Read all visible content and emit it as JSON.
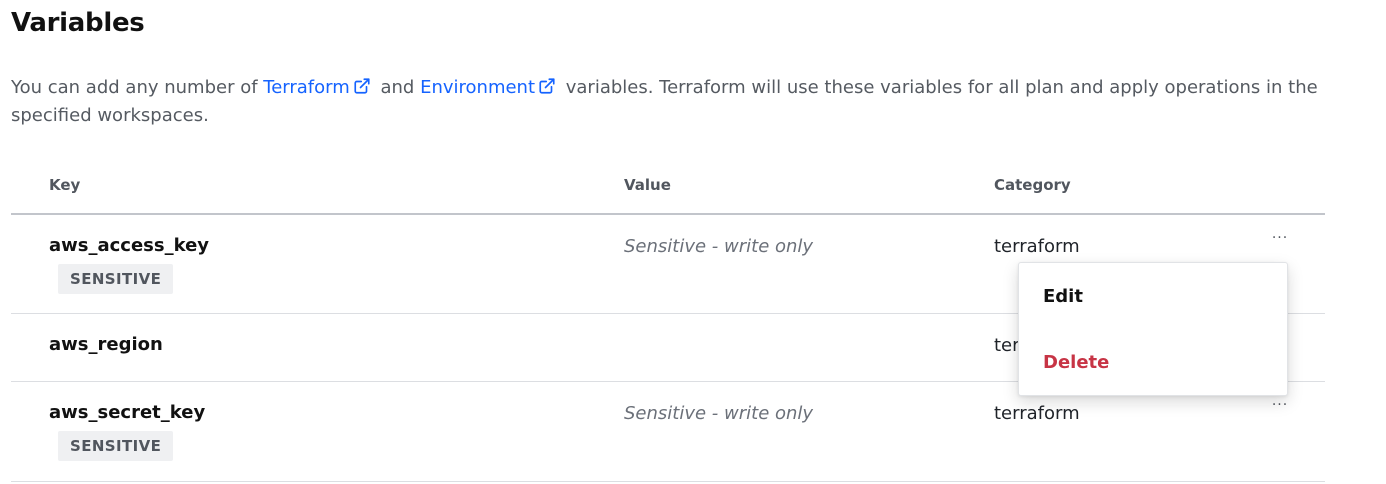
{
  "page": {
    "title": "Variables",
    "intro": {
      "before": "You can add any number of ",
      "link_terraform": "Terraform",
      "middle": " and ",
      "link_environment": "Environment",
      "after": " variables. Terraform will use these variables for all plan and apply operations in the specified workspaces."
    }
  },
  "table": {
    "headers": {
      "key": "Key",
      "value": "Value",
      "category": "Category"
    },
    "rows": [
      {
        "key": "aws_access_key",
        "badge": "SENSITIVE",
        "value": "Sensitive - write only",
        "category": "terraform",
        "more": "···"
      },
      {
        "key": "aws_region",
        "badge": "",
        "value": "",
        "category": "terraform",
        "more": "···"
      },
      {
        "key": "aws_secret_key",
        "badge": "SENSITIVE",
        "value": "Sensitive - write only",
        "category": "terraform",
        "more": "···"
      }
    ]
  },
  "menu": {
    "edit": "Edit",
    "delete": "Delete"
  },
  "colors": {
    "link": "#1563ff",
    "danger": "#c73445",
    "badge_bg": "#eff0f2"
  }
}
